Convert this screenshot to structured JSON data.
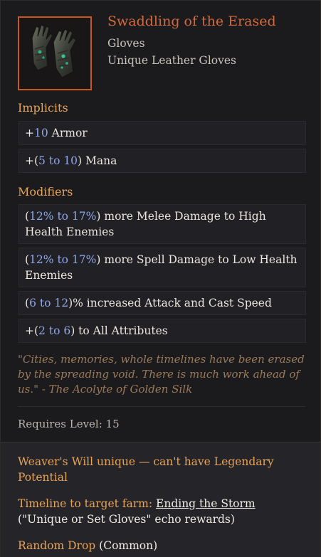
{
  "item": {
    "name": "Swaddling of the Erased",
    "base_type": "Gloves",
    "rarity_type": "Unique Leather Gloves",
    "icon": "gloves-icon"
  },
  "implicits": {
    "heading": "Implicits",
    "lines": [
      {
        "prefix": "+",
        "value": "10",
        "suffix": " Armor"
      },
      {
        "prefix": "+(",
        "value": "5 to 10",
        "suffix": ") Mana"
      }
    ]
  },
  "modifiers": {
    "heading": "Modifiers",
    "lines": [
      {
        "prefix": "(",
        "value": "12% to 17%",
        "suffix": ") more Melee Damage to High Health Enemies"
      },
      {
        "prefix": "(",
        "value": "12% to 17%",
        "suffix": ") more Spell Damage to Low Health Enemies"
      },
      {
        "prefix": "(",
        "value": "6 to 12",
        "suffix": ")% increased Attack and Cast Speed"
      },
      {
        "prefix": "+(",
        "value": "2 to 6",
        "suffix": ") to All Attributes"
      }
    ]
  },
  "lore": "\"Cities, memories, whole timelines have been erased by the spreading void. There is much work ahead of us.\" - The Acolyte of Golden Silk",
  "requirement": "Requires Level: 15",
  "footer": {
    "note": "Weaver's Will unique — can't have Legendary Potential",
    "farm_label": "Timeline to target farm: ",
    "farm_link": "Ending the Storm",
    "farm_rest": " (\"Unique or Set Gloves\" echo rewards)",
    "drop_label": "Random Drop",
    "drop_rest": " (Common)"
  },
  "colors": {
    "name": "#d46a3c",
    "heading": "#e6a45a",
    "value": "#8fa8ea",
    "lore": "#9b7a5a",
    "icon_border": "#c8581e"
  }
}
